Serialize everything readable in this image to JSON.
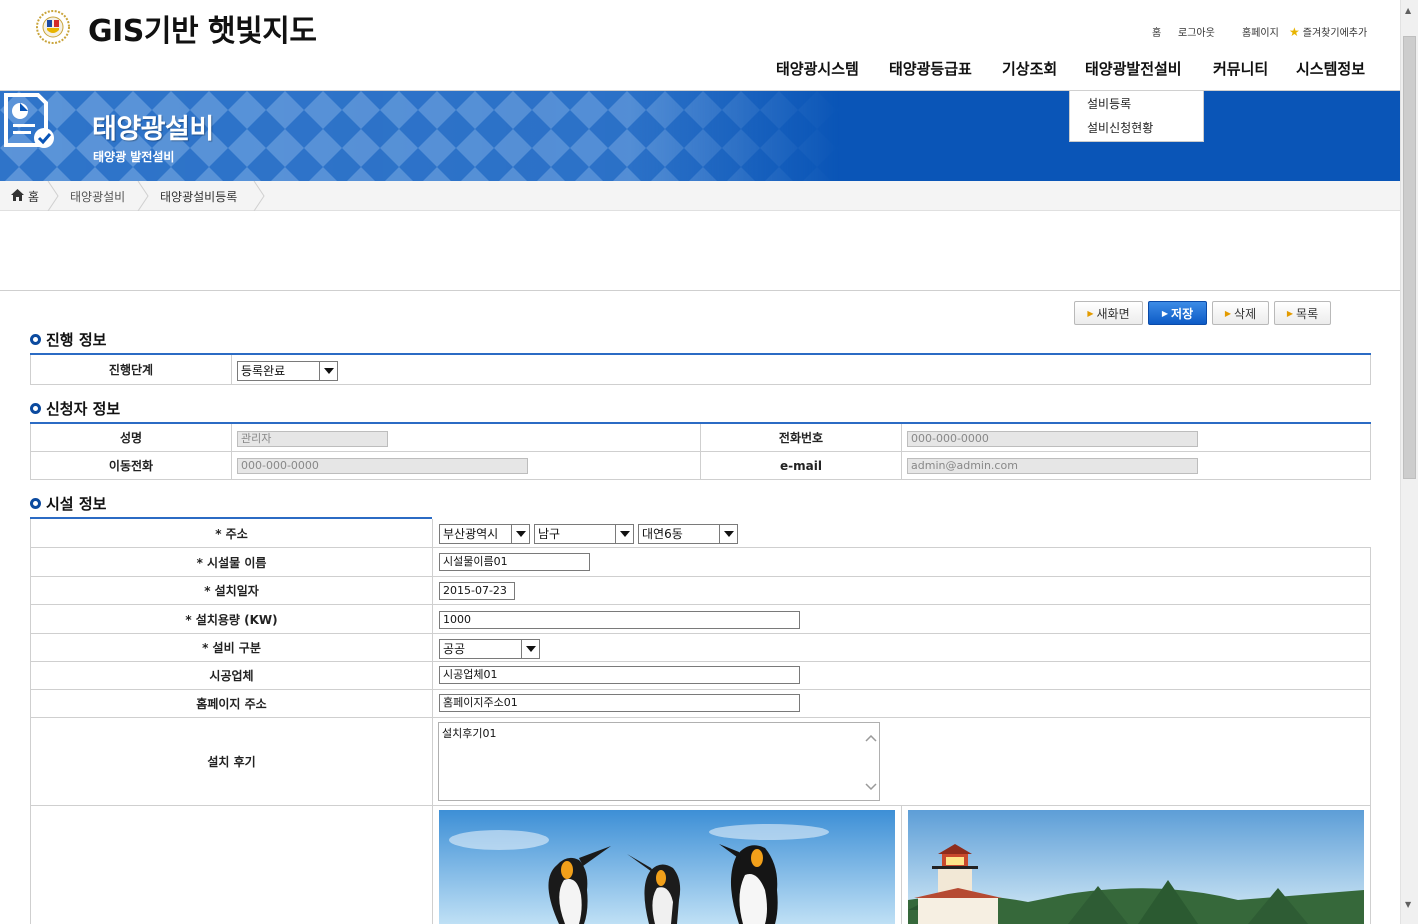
{
  "header": {
    "site_title": "GIS기반 햇빛지도",
    "util_links": [
      "홈",
      "로그아웃",
      "홈페이지",
      "즐겨찾기에추가"
    ],
    "gnb": [
      "태양광시스템",
      "태양광등급표",
      "기상조회",
      "태양광발전설비",
      "커뮤니티",
      "시스템정보"
    ],
    "submenu": [
      "설비등록",
      "설비신청현황"
    ]
  },
  "banner": {
    "title": "태양광설비",
    "subtitle": "태양광 발전설비"
  },
  "breadcrumb": [
    "홈",
    "태양광설비",
    "태양광설비등록"
  ],
  "buttons": {
    "new": "새화면",
    "save": "저장",
    "delete": "삭제",
    "list": "목록"
  },
  "progress": {
    "title": "진행 정보",
    "stage_label": "진행단계",
    "stage_value": "등록완료"
  },
  "applicant": {
    "title": "신청자 정보",
    "name_label": "성명",
    "name_value": "관리자",
    "phone_label": "전화번호",
    "phone_value": "000-000-0000",
    "mobile_label": "이동전화",
    "mobile_value": "000-000-0000",
    "email_label": "e-mail",
    "email_value": "admin@admin.com"
  },
  "facility": {
    "title": "시설 정보",
    "address_label": "* 주소",
    "address_city": "부산광역시",
    "address_district": "남구",
    "address_dong": "대연6동",
    "name_label": "* 시설물 이름",
    "name_value": "시설물이름01",
    "date_label": "* 설치일자",
    "date_value": "2015-07-23",
    "capacity_label": "* 설치용량 (KW)",
    "capacity_value": "1000",
    "category_label": "* 설비 구분",
    "category_value": "공공",
    "builder_label": "시공업체",
    "builder_value": "시공업체01",
    "homepage_label": "홈페이지 주소",
    "homepage_value": "홈페이지주소01",
    "review_label": "설치 후기",
    "review_value": "설치후기01"
  },
  "colors": {
    "accent_blue": "#0a55b7",
    "table_top_border": "#2b6bc4",
    "save_button": "#0d5bc6"
  }
}
